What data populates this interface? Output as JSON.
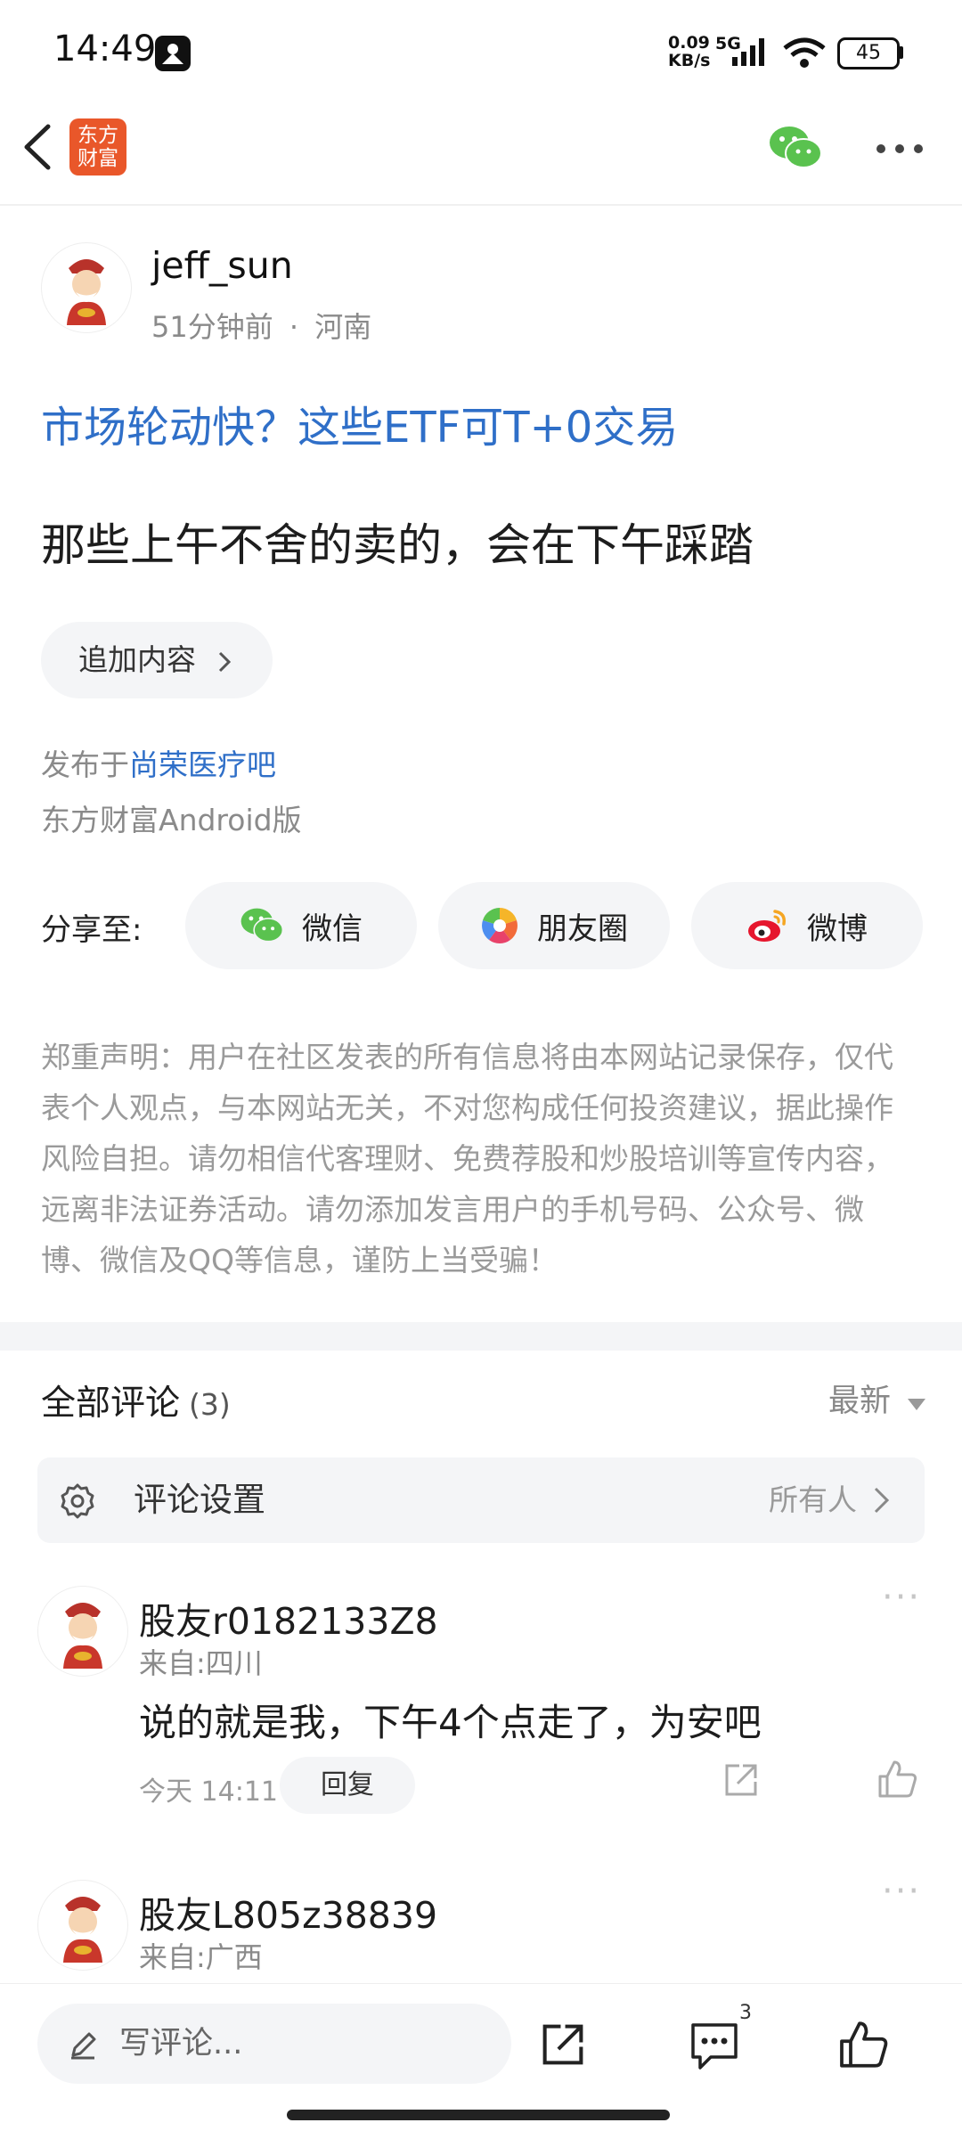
{
  "status_bar": {
    "time": "14:49",
    "network_speed": "0.09\nKB/s",
    "net_type": "5G",
    "battery": "45"
  },
  "header": {
    "logo_text": "东方\n财富",
    "back_icon": "chevron-left-icon",
    "wechat_icon": "wechat-icon",
    "more_icon": "more-icon"
  },
  "post": {
    "author": "jeff_sun",
    "time": "51分钟前",
    "location": "河南",
    "title": "市场轮动快？这些ETF可T+0交易",
    "content": "那些上午不舍的卖的，会在下午踩踏",
    "add_content": "追加内容",
    "published_prefix": "发布于",
    "forum": "尚荣医疗吧",
    "client": "东方财富Android版"
  },
  "share": {
    "label": "分享至:",
    "buttons": [
      {
        "label": "微信",
        "icon": "wechat-icon"
      },
      {
        "label": "朋友圈",
        "icon": "moments-icon"
      },
      {
        "label": "微博",
        "icon": "weibo-icon"
      }
    ]
  },
  "disclaimer": "郑重声明：用户在社区发表的所有信息将由本网站记录保存，仅代表个人观点，与本网站无关，不对您构成任何投资建议，据此操作风险自担。请勿相信代客理财、免费荐股和炒股培训等宣传内容，远离非法证券活动。请勿添加发言用户的手机号码、公众号、微博、微信及QQ等信息，谨防上当受骗！",
  "comments": {
    "title": "全部评论",
    "count": "(3)",
    "sort": "最新",
    "settings_label": "评论设置",
    "settings_value": "所有人",
    "items": [
      {
        "name": "股友r0182133Z8",
        "from": "来自:四川",
        "text": "说的就是我，下午4个点走了，为安吧",
        "time": "今天 14:11",
        "reply": "回复"
      },
      {
        "name": "股友L805z38839",
        "from": "来自:广西"
      }
    ]
  },
  "bottom_bar": {
    "placeholder": "写评论...",
    "comment_badge": "3"
  },
  "colors": {
    "link_blue": "#2f6fc8",
    "brand_orange": "#e9572a",
    "wechat_green": "#5ac24f",
    "weibo_red": "#e6162d"
  }
}
